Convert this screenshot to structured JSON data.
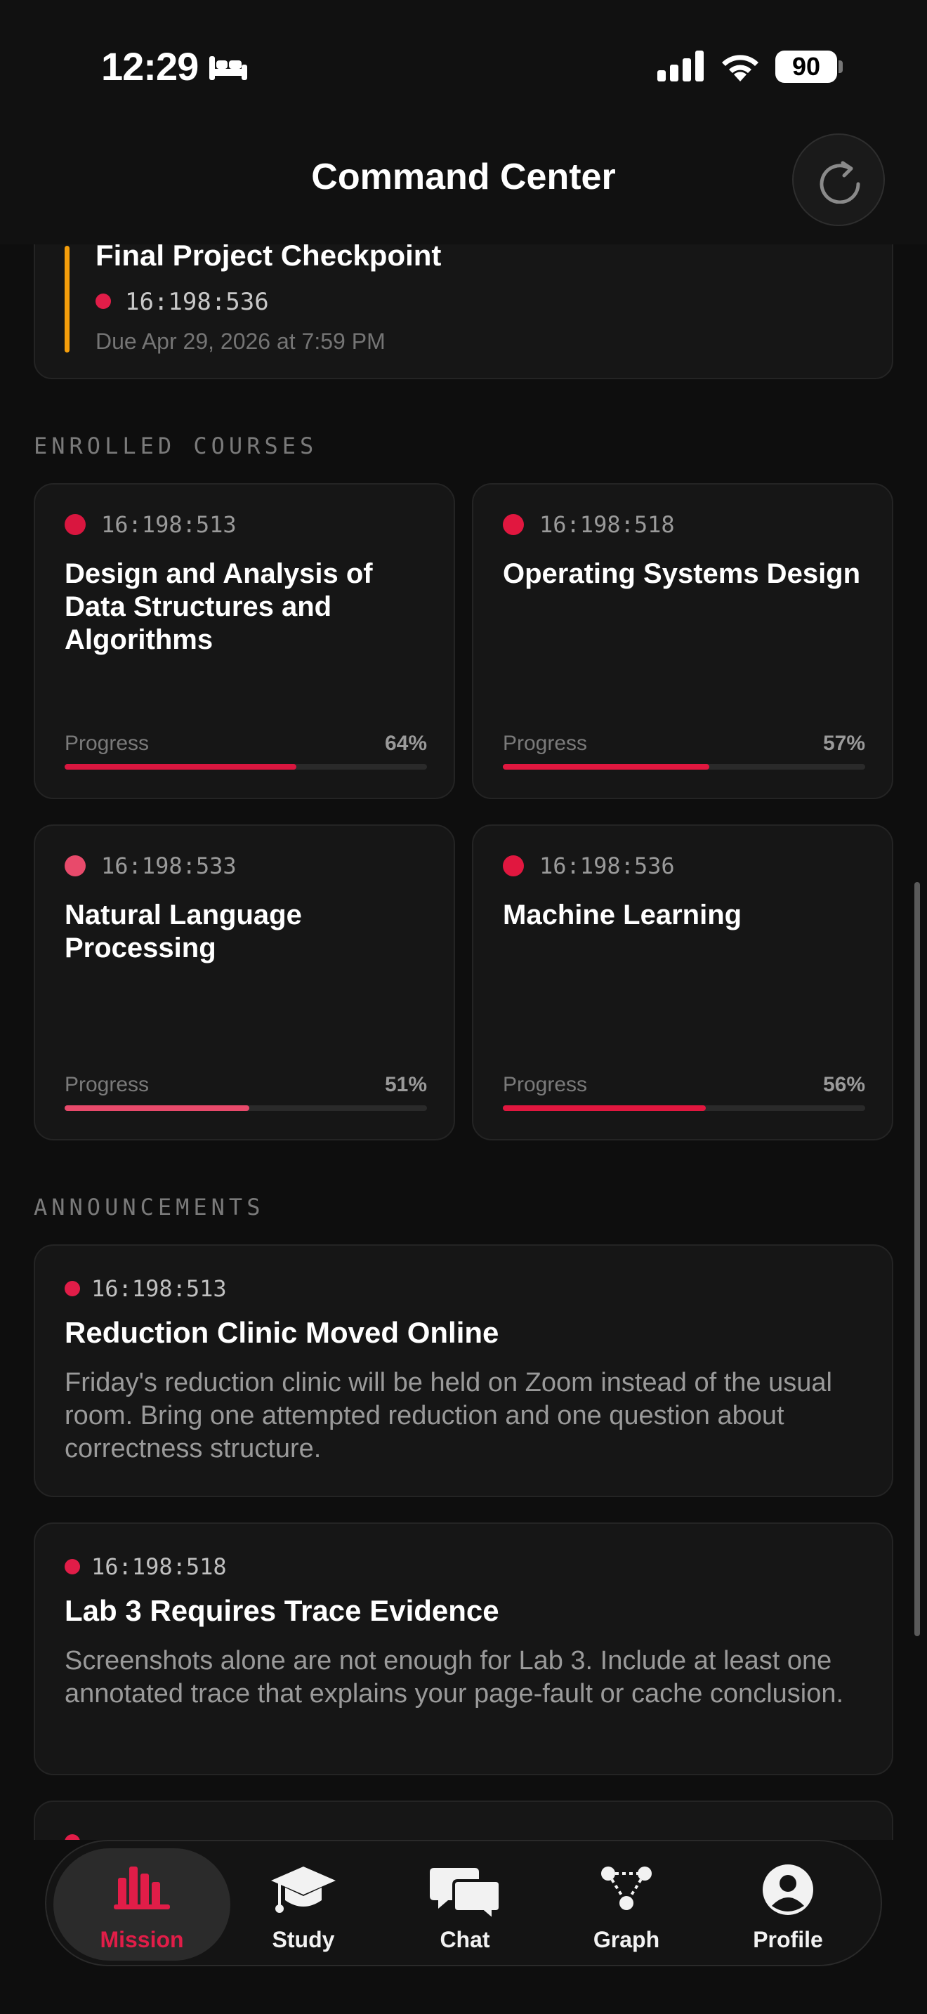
{
  "status_bar": {
    "time": "12:29",
    "battery": "90"
  },
  "header": {
    "title": "Command Center"
  },
  "deadline": {
    "title": "Final Project Checkpoint",
    "course_code": "16:198:536",
    "due": "Due Apr 29, 2026 at 7:59 PM",
    "accent_color": "#f59e0b"
  },
  "enrolled": {
    "heading": "ENROLLED COURSES",
    "progress_label": "Progress",
    "courses": [
      {
        "code": "16:198:513",
        "title": "Design and Analysis of Data Structures and Algorithms",
        "progress": "64%",
        "progress_value": 0.64,
        "color": "#d9163f"
      },
      {
        "code": "16:198:518",
        "title": "Operating Systems Design",
        "progress": "57%",
        "progress_value": 0.57,
        "color": "#e1173f"
      },
      {
        "code": "16:198:533",
        "title": "Natural Language Processing",
        "progress": "51%",
        "progress_value": 0.51,
        "color": "#e84a6b"
      },
      {
        "code": "16:198:536",
        "title": "Machine Learning",
        "progress": "56%",
        "progress_value": 0.56,
        "color": "#e1173f"
      }
    ]
  },
  "announcements": {
    "heading": "ANNOUNCEMENTS",
    "items": [
      {
        "code": "16:198:513",
        "title": "Reduction Clinic Moved Online",
        "body": "Friday's reduction clinic will be held on Zoom instead of the usual room. Bring one attempted reduction and one question about correctness structure."
      },
      {
        "code": "16:198:518",
        "title": "Lab 3 Requires Trace Evidence",
        "body": "Screenshots alone are not enough for Lab 3. Include at least one annotated trace that explains your page-fault or cache conclusion."
      }
    ]
  },
  "tabs": [
    {
      "label": "Mission",
      "icon": "bar-chart-icon",
      "active": true
    },
    {
      "label": "Study",
      "icon": "graduation-cap-icon",
      "active": false
    },
    {
      "label": "Chat",
      "icon": "chat-bubbles-icon",
      "active": false
    },
    {
      "label": "Graph",
      "icon": "graph-nodes-icon",
      "active": false
    },
    {
      "label": "Profile",
      "icon": "profile-icon",
      "active": false
    }
  ],
  "colors": {
    "accent": "#e11d48",
    "background": "#0e0e0e",
    "card": "#161616"
  }
}
